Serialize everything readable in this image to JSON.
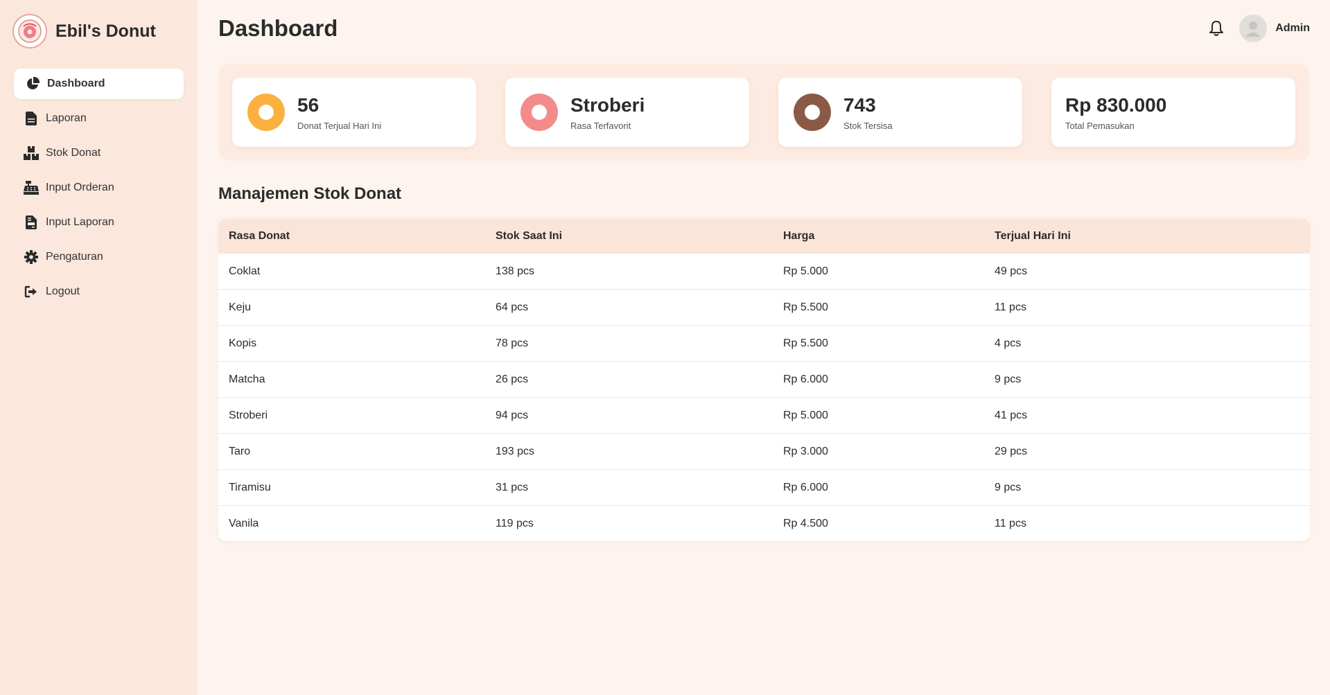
{
  "brand": {
    "title": "Ebil's Donut"
  },
  "sidebar": {
    "items": [
      {
        "label": "Dashboard",
        "icon": "pie-chart-icon",
        "active": true
      },
      {
        "label": "Laporan",
        "icon": "document-icon"
      },
      {
        "label": "Stok Donat",
        "icon": "boxes-icon"
      },
      {
        "label": "Input Orderan",
        "icon": "cash-register-icon"
      },
      {
        "label": "Input Laporan",
        "icon": "file-invoice-icon"
      },
      {
        "label": "Pengaturan",
        "icon": "gear-icon"
      },
      {
        "label": "Logout",
        "icon": "logout-icon"
      }
    ]
  },
  "header": {
    "title": "Dashboard",
    "user": "Admin"
  },
  "stats": [
    {
      "value": "56",
      "label": "Donat Terjual Hari Ini",
      "color": "#fbb040"
    },
    {
      "value": "Stroberi",
      "label": "Rasa Terfavorit",
      "color": "#f38b8b"
    },
    {
      "value": "743",
      "label": "Stok Tersisa",
      "color": "#8a5a47"
    },
    {
      "value": "Rp 830.000",
      "label": "Total Pemasukan"
    }
  ],
  "stock": {
    "title": "Manajemen Stok Donat",
    "columns": [
      "Rasa Donat",
      "Stok Saat Ini",
      "Harga",
      "Terjual Hari Ini"
    ],
    "rows": [
      [
        "Coklat",
        "138 pcs",
        "Rp 5.000",
        "49 pcs"
      ],
      [
        "Keju",
        "64 pcs",
        "Rp 5.500",
        "11 pcs"
      ],
      [
        "Kopis",
        "78 pcs",
        "Rp 5.500",
        "4 pcs"
      ],
      [
        "Matcha",
        "26 pcs",
        "Rp 6.000",
        "9 pcs"
      ],
      [
        "Stroberi",
        "94 pcs",
        "Rp 5.000",
        "41 pcs"
      ],
      [
        "Taro",
        "193 pcs",
        "Rp 3.000",
        "29 pcs"
      ],
      [
        "Tiramisu",
        "31 pcs",
        "Rp 6.000",
        "9 pcs"
      ],
      [
        "Vanila",
        "119 pcs",
        "Rp 4.500",
        "11 pcs"
      ]
    ]
  }
}
